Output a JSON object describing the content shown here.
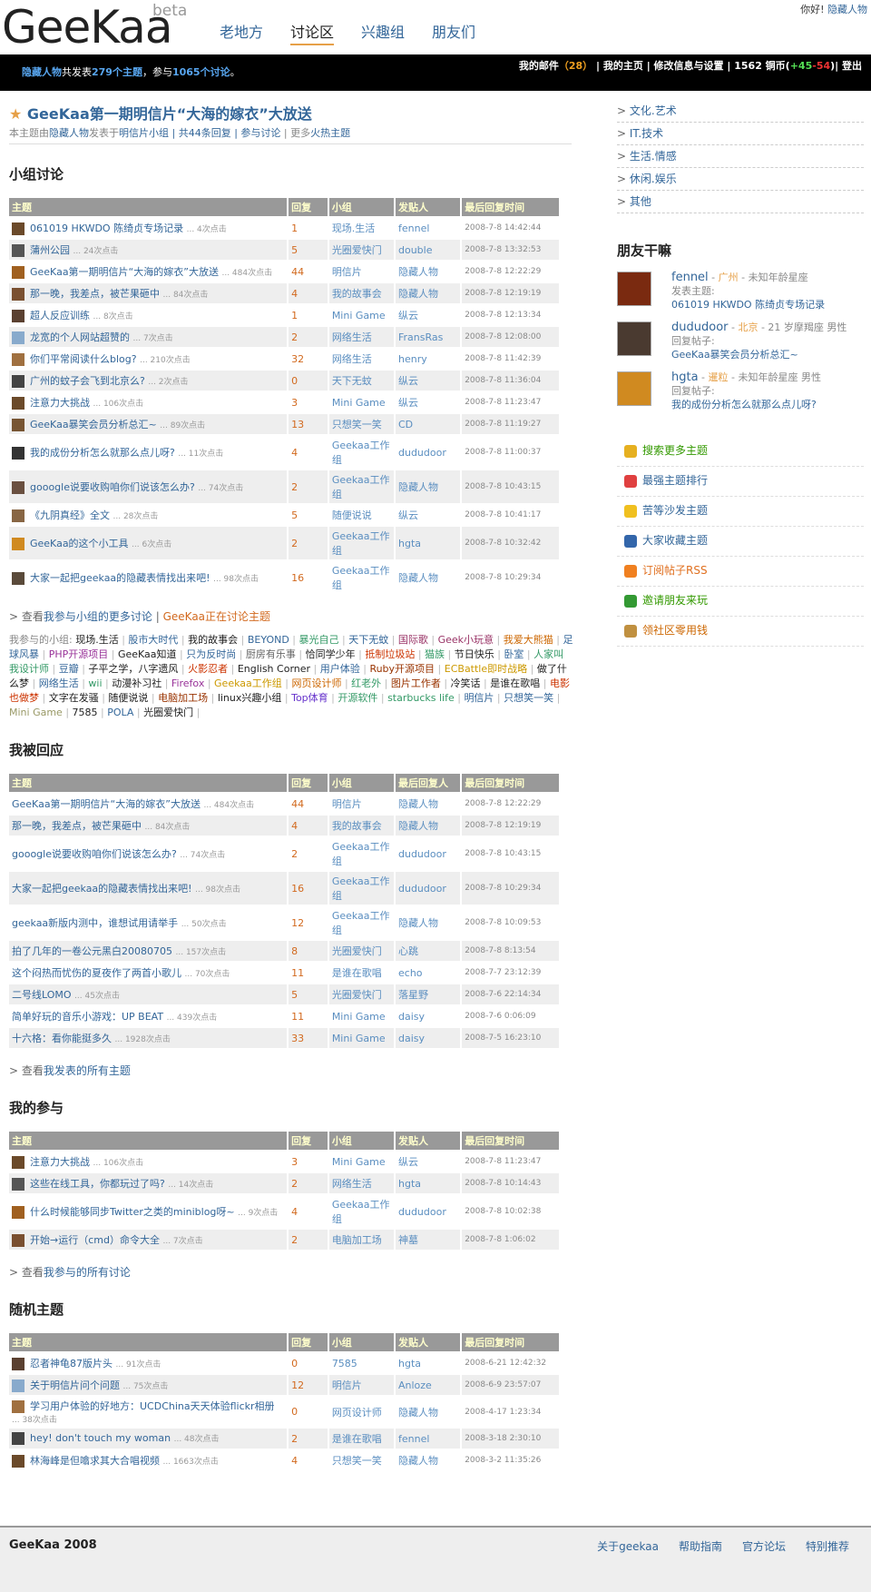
{
  "header": {
    "logo": "GeeKaa",
    "beta": "beta",
    "nav": [
      "老地方",
      "讨论区",
      "兴趣组",
      "朋友们"
    ],
    "hello": "你好!",
    "user": "隐藏人物"
  },
  "bar": {
    "user": "隐藏人物",
    "posted_pre": "共发表",
    "topics": "279个主题",
    "mid": "，参与",
    "discuss": "1065个讨论",
    "end": "。",
    "mail": "我的邮件",
    "mail_count": "（28）",
    "home": "| 我的主页",
    "settings": "| 修改信息与设置",
    "coins_pre": "| 1562 铜币(",
    "coins_plus": "+45",
    "coins_minus": "-54",
    "coins_end": ")| 登出"
  },
  "topic": {
    "title": "GeeKaa第一期明信片“大海的嫁衣”大放送",
    "sub_pre": "本主题由",
    "sub_user": "隐藏人物",
    "sub_mid": "发表于",
    "sub_group": "明信片小组",
    "sub_replies": "| 共44条回复",
    "sub_join": "| 参与讨论",
    "sub_more": "| 更多",
    "sub_hot": "火热主题"
  },
  "heads": {
    "topic": "主题",
    "reply": "回复",
    "group": "小组",
    "poster": "发贴人",
    "last": "最后回复时间",
    "lastrep": "最后回复人"
  },
  "sec1": "小组讨论",
  "rows1": [
    [
      "061019 HKWDO 陈绮贞专场记录",
      "... 4次点击",
      "1",
      "现场.生活",
      "fennel",
      "2008-7-8 14:42:44"
    ],
    [
      "蒲州公园",
      "... 24次点击",
      "5",
      "光圈爱快门",
      "double",
      "2008-7-8 13:32:53"
    ],
    [
      "GeeKaa第一期明信片“大海的嫁衣”大放送",
      "... 484次点击",
      "44",
      "明信片",
      "隐藏人物",
      "2008-7-8 12:22:29"
    ],
    [
      "那一晚，我差点，被芒果砸中",
      "... 84次点击",
      "4",
      "我的故事会",
      "隐藏人物",
      "2008-7-8 12:19:19"
    ],
    [
      "超人反应训练",
      "... 8次点击",
      "1",
      "Mini Game",
      "纵云",
      "2008-7-8 12:13:34"
    ],
    [
      "龙宽的个人网站超赞的",
      "... 7次点击",
      "2",
      "网络生活",
      "FransRas",
      "2008-7-8 12:08:00"
    ],
    [
      "你们平常阅读什么blog?",
      "... 210次点击",
      "32",
      "网络生活",
      "henry",
      "2008-7-8 11:42:39"
    ],
    [
      "广州的蚊子会飞到北京么?",
      "... 2次点击",
      "0",
      "天下无蚊",
      "纵云",
      "2008-7-8 11:36:04"
    ],
    [
      "注意力大挑战",
      "... 106次点击",
      "3",
      "Mini Game",
      "纵云",
      "2008-7-8 11:23:47"
    ],
    [
      "GeeKaa暴笑会员分析总汇~",
      "... 89次点击",
      "13",
      "只想笑一笑",
      "CD",
      "2008-7-8 11:19:27"
    ],
    [
      "我的成份分析怎么就那么点儿呀?",
      "... 11次点击",
      "4",
      "Geekaa工作组",
      "dududoor",
      "2008-7-8 11:00:37"
    ],
    [
      "gooogle说要收购咱你们说该怎么办?",
      "... 74次点击",
      "2",
      "Geekaa工作组",
      "隐藏人物",
      "2008-7-8 10:43:15"
    ],
    [
      "《九阴真经》全文",
      "... 28次点击",
      "5",
      "随便说说",
      "纵云",
      "2008-7-8 10:41:17"
    ],
    [
      "GeeKaa的这个小工具",
      "... 6次点击",
      "2",
      "Geekaa工作组",
      "hgta",
      "2008-7-8 10:32:42"
    ],
    [
      "大家一起把geekaa的隐藏表情找出来吧!",
      "... 98次点击",
      "16",
      "Geekaa工作组",
      "隐藏人物",
      "2008-7-8 10:29:34"
    ]
  ],
  "more1": {
    "pre": "> 查看",
    "link": "我参与小组的更多讨论",
    "sep": "|",
    "hot": "GeeKaa正在讨论主题"
  },
  "groups_label": "我参与的小组:",
  "groups": [
    "现场.生活",
    "股市大时代",
    "我的故事会",
    "BEYOND",
    "暴光自己",
    "天下无蚊",
    "国际歌",
    "Geek小玩意",
    "我爱大熊猫",
    "足球风暴",
    "PHP开源项目",
    "GeeKaa知道",
    "只为反时尚",
    "厨房有乐事",
    "恰同学少年",
    "抵制垃圾站",
    "猫族",
    "节日快乐",
    "卧室",
    "人家叫我设计师",
    "豆瓣",
    "子平之学，八字遗风",
    "火影忍者",
    "English Corner",
    "用户体验",
    "Ruby开源项目",
    "ECBattle即时战略",
    "做了什么梦",
    "网络生活",
    "wii",
    "动漫补习社",
    "Firefox",
    "Geekaa工作组",
    "网页设计师",
    "红老外",
    "图片工作者",
    "冷笑话",
    "是谁在歌唱",
    "电影也做梦",
    "文字在发骚",
    "随便说说",
    "电脑加工场",
    "linux兴趣小组",
    "Top体育",
    "开源软件",
    "starbucks life",
    "明信片",
    "只想笑一笑",
    "Mini Game",
    "7585",
    "POLA",
    "光圈爱快门"
  ],
  "group_colors": [
    "#222",
    "#336699",
    "#222",
    "#336699",
    "#339966",
    "#336699",
    "#993366",
    "#993366",
    "#cc6600",
    "#336699",
    "#993399",
    "#222",
    "#336699",
    "#666",
    "#222",
    "#cc3300",
    "#339966",
    "#222",
    "#336699",
    "#339966",
    "#336699",
    "#222",
    "#cc3300",
    "#222",
    "#336699",
    "#993300",
    "#cc9900",
    "#222",
    "#336699",
    "#339966",
    "#222",
    "#993399",
    "#cc9900",
    "#cc6600",
    "#339966",
    "#993300",
    "#222",
    "#222",
    "#cc3300",
    "#222",
    "#222",
    "#993300",
    "#222",
    "#6633cc",
    "#339966",
    "#339966",
    "#336699",
    "#336699",
    "#999966",
    "#222",
    "#336699",
    "#222"
  ],
  "sec2": "我被回应",
  "rows2": [
    [
      "GeeKaa第一期明信片“大海的嫁衣”大放送",
      "... 484次点击",
      "44",
      "明信片",
      "隐藏人物",
      "2008-7-8 12:22:29"
    ],
    [
      "那一晚，我差点，被芒果砸中",
      "... 84次点击",
      "4",
      "我的故事会",
      "隐藏人物",
      "2008-7-8 12:19:19"
    ],
    [
      "gooogle说要收购咱你们说该怎么办?",
      "... 74次点击",
      "2",
      "Geekaa工作组",
      "dududoor",
      "2008-7-8 10:43:15"
    ],
    [
      "大家一起把geekaa的隐藏表情找出来吧!",
      "... 98次点击",
      "16",
      "Geekaa工作组",
      "dududoor",
      "2008-7-8 10:29:34"
    ],
    [
      "geekaa新版内测中，谁想试用请举手",
      "... 50次点击",
      "12",
      "Geekaa工作组",
      "隐藏人物",
      "2008-7-8 10:09:53"
    ],
    [
      "拍了几年的一卷公元黑白20080705",
      "... 157次点击",
      "8",
      "光圈爱快门",
      "心跳",
      "2008-7-8 8:13:54"
    ],
    [
      "这个闷热而忧伤的夏夜作了两首小歌儿",
      "... 70次点击",
      "11",
      "是谁在歌唱",
      "echo",
      "2008-7-7 23:12:39"
    ],
    [
      "二号线LOMO",
      "... 45次点击",
      "5",
      "光圈爱快门",
      "落星野",
      "2008-7-6 22:14:34"
    ],
    [
      "简单好玩的音乐小游戏：UP BEAT",
      "... 439次点击",
      "11",
      "Mini Game",
      "daisy",
      "2008-7-6 0:06:09"
    ],
    [
      "十六格：看你能挺多久",
      "... 1928次点击",
      "33",
      "Mini Game",
      "daisy",
      "2008-7-5 16:23:10"
    ]
  ],
  "more2": {
    "pre": "> 查看",
    "link": "我发表的所有主题"
  },
  "sec3": "我的参与",
  "rows3": [
    [
      "注意力大挑战",
      "... 106次点击",
      "3",
      "Mini Game",
      "纵云",
      "2008-7-8 11:23:47"
    ],
    [
      "这些在线工具，你都玩过了吗?",
      "... 14次点击",
      "2",
      "网络生活",
      "hgta",
      "2008-7-8 10:14:43"
    ],
    [
      "什么时候能够同步Twitter之类的miniblog呀~",
      "... 9次点击",
      "4",
      "Geekaa工作组",
      "dududoor",
      "2008-7-8 10:02:38"
    ],
    [
      "开始→运行（cmd）命令大全",
      "... 7次点击",
      "2",
      "电脑加工场",
      "神墓",
      "2008-7-8 1:06:02"
    ]
  ],
  "more3": {
    "pre": "> 查看",
    "link": "我参与的所有讨论"
  },
  "sec4": "随机主题",
  "rows4": [
    [
      "忍者神龟87版片头",
      "... 91次点击",
      "0",
      "7585",
      "hgta",
      "2008-6-21 12:42:32"
    ],
    [
      "关于明信片问个问题",
      "... 75次点击",
      "12",
      "明信片",
      "Anloze",
      "2008-6-9 23:57:07"
    ],
    [
      "学习用户体验的好地方：UCDChina天天体验flickr相册",
      "... 38次点击",
      "0",
      "网页设计师",
      "隐藏人物",
      "2008-4-17 1:23:34"
    ],
    [
      "hey! don't touch my woman",
      "... 48次点击",
      "2",
      "是谁在歌唱",
      "fennel",
      "2008-3-18 2:30:10"
    ],
    [
      "林海峰是但噏求其大合唱视频",
      "... 1663次点击",
      "4",
      "只想笑一笑",
      "隐藏人物",
      "2008-3-2 11:35:26"
    ]
  ],
  "side": {
    "cats": [
      "文化.艺术",
      "IT.技术",
      "生活.情感",
      "休闲.娱乐",
      "其他"
    ],
    "friends_title": "朋友干嘛",
    "friends": [
      {
        "name": "fennel",
        "loc": "广州",
        "age": "- 未知年龄星座",
        "act": "发表主题:",
        "msg": "061019 HKWDO 陈绮贞专场记录"
      },
      {
        "name": "dududoor",
        "loc": "北京",
        "age": "- 21 岁摩羯座 男性",
        "act": "回复帖子:",
        "msg": "GeeKaa暴笑会员分析总汇~"
      },
      {
        "name": "hgta",
        "loc": "暹粒",
        "age": "- 未知年龄星座 男性",
        "act": "回复帖子:",
        "msg": "我的成份分析怎么就那么点儿呀?"
      }
    ],
    "links": [
      "搜索更多主题",
      "最强主题排行",
      "苦等沙发主题",
      "大家收藏主题",
      "订阅帖子RSS",
      "邀请朋友来玩",
      "领社区零用钱"
    ],
    "link_colors": [
      "#339900",
      "#336699",
      "#336699",
      "#336699",
      "#e07020",
      "#339900",
      "#cc6600"
    ],
    "icon_colors": [
      "#e6b020",
      "#e04040",
      "#f0c020",
      "#3366aa",
      "#f08020",
      "#339933",
      "#c09040"
    ]
  },
  "footer": {
    "copy": "GeeKaa 2008",
    "links": [
      "关于geekaa",
      "帮助指南",
      "官方论坛",
      "特别推荐"
    ]
  }
}
